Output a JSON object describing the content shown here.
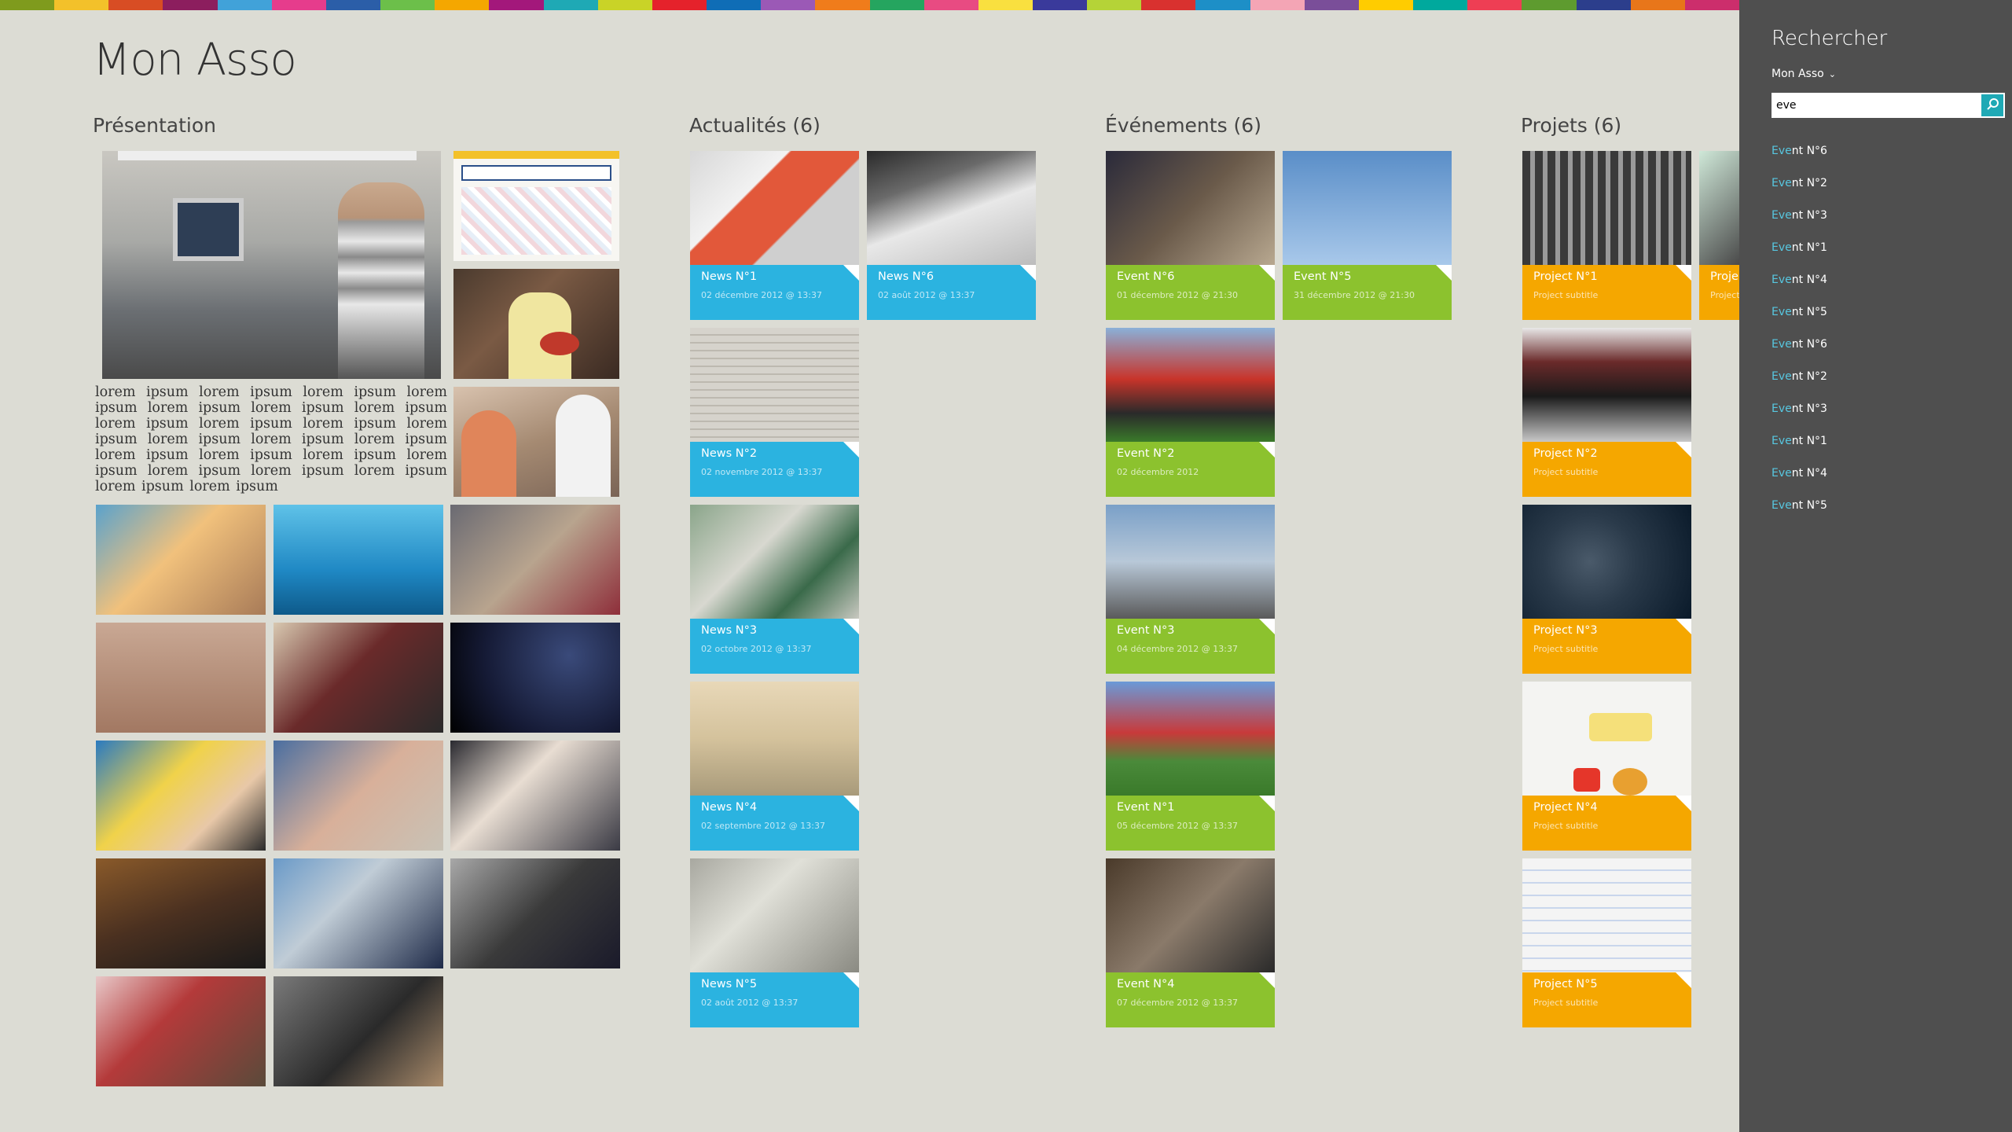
{
  "app": {
    "title": "Mon Asso"
  },
  "colors": {
    "stripe": [
      "#7f9b1d",
      "#f3c12a",
      "#d84d24",
      "#8c1e5e",
      "#41a2d9",
      "#e63c8c",
      "#2b5ea8",
      "#6cbf4a",
      "#f5a700",
      "#a3187b",
      "#1fa9b5",
      "#c9d327",
      "#e5222b",
      "#0f6db6",
      "#9b59b6",
      "#f07c1b",
      "#25a55f",
      "#e84b82",
      "#f9e03f",
      "#3a3a9b",
      "#b5d337",
      "#d9312f",
      "#1d8fc7",
      "#f4a5b5",
      "#7a4e99",
      "#ffcc00",
      "#00a99d",
      "#ee3e54",
      "#5e9b2f",
      "#2c3e8c",
      "#e8761a",
      "#cc2e6c"
    ],
    "news": "#2bb3e0",
    "events": "#8cc22e",
    "projects": "#f5a700"
  },
  "sections": {
    "presentation": {
      "title": "Présentation",
      "text": "lorem ipsum lorem ipsum lorem ipsum lorem ipsum lorem ipsum lorem ipsum lorem ipsum lorem ipsum lorem ipsum lorem ipsum lorem ipsum lorem ipsum lorem ipsum lorem ipsum lorem ipsum lorem ipsum lorem ipsum lorem ipsum lorem ipsum lorem ipsum lorem ipsum lorem ipsum lorem ipsum"
    },
    "news": {
      "title": "Actualités (6)",
      "items": [
        {
          "title": "News N°1",
          "sub": "02 décembre 2012 @ 13:37"
        },
        {
          "title": "News N°6",
          "sub": "02 août 2012 @ 13:37"
        },
        {
          "title": "News N°2",
          "sub": "02 novembre 2012 @ 13:37"
        },
        {
          "title": "News N°3",
          "sub": "02 octobre 2012 @ 13:37"
        },
        {
          "title": "News N°4",
          "sub": "02 septembre 2012 @ 13:37"
        },
        {
          "title": "News N°5",
          "sub": "02 août 2012 @ 13:37"
        }
      ]
    },
    "events": {
      "title": "Événements (6)",
      "items": [
        {
          "title": "Event N°6",
          "sub": "01 décembre 2012 @ 21:30"
        },
        {
          "title": "Event N°5",
          "sub": "31 décembre 2012 @ 21:30"
        },
        {
          "title": "Event N°2",
          "sub": "02 décembre 2012"
        },
        {
          "title": "Event N°3",
          "sub": "04 décembre 2012 @ 13:37"
        },
        {
          "title": "Event N°1",
          "sub": "05 décembre 2012 @ 13:37"
        },
        {
          "title": "Event N°4",
          "sub": "07 décembre 2012 @ 13:37"
        }
      ]
    },
    "projects": {
      "title": "Projets (6)",
      "items": [
        {
          "title": "Project N°1",
          "sub": "Project subtitle"
        },
        {
          "title": "Proje",
          "sub": "Project"
        },
        {
          "title": "Project N°2",
          "sub": "Project subtitle"
        },
        {
          "title": "Project N°3",
          "sub": "Project subtitle"
        },
        {
          "title": "Project N°4",
          "sub": "Project subtitle"
        },
        {
          "title": "Project N°5",
          "sub": "Project subtitle"
        }
      ]
    }
  },
  "search": {
    "title": "Rechercher",
    "scope": "Mon Asso",
    "query": "eve",
    "results": [
      {
        "match": "Eve",
        "rest": "nt N°6"
      },
      {
        "match": "Eve",
        "rest": "nt N°2"
      },
      {
        "match": "Eve",
        "rest": "nt N°3"
      },
      {
        "match": "Eve",
        "rest": "nt N°1"
      },
      {
        "match": "Eve",
        "rest": "nt N°4"
      },
      {
        "match": "Eve",
        "rest": "nt N°5"
      },
      {
        "match": "Eve",
        "rest": "nt N°6"
      },
      {
        "match": "Eve",
        "rest": "nt N°2"
      },
      {
        "match": "Eve",
        "rest": "nt N°3"
      },
      {
        "match": "Eve",
        "rest": "nt N°1"
      },
      {
        "match": "Eve",
        "rest": "nt N°4"
      },
      {
        "match": "Eve",
        "rest": "nt N°5"
      }
    ]
  }
}
